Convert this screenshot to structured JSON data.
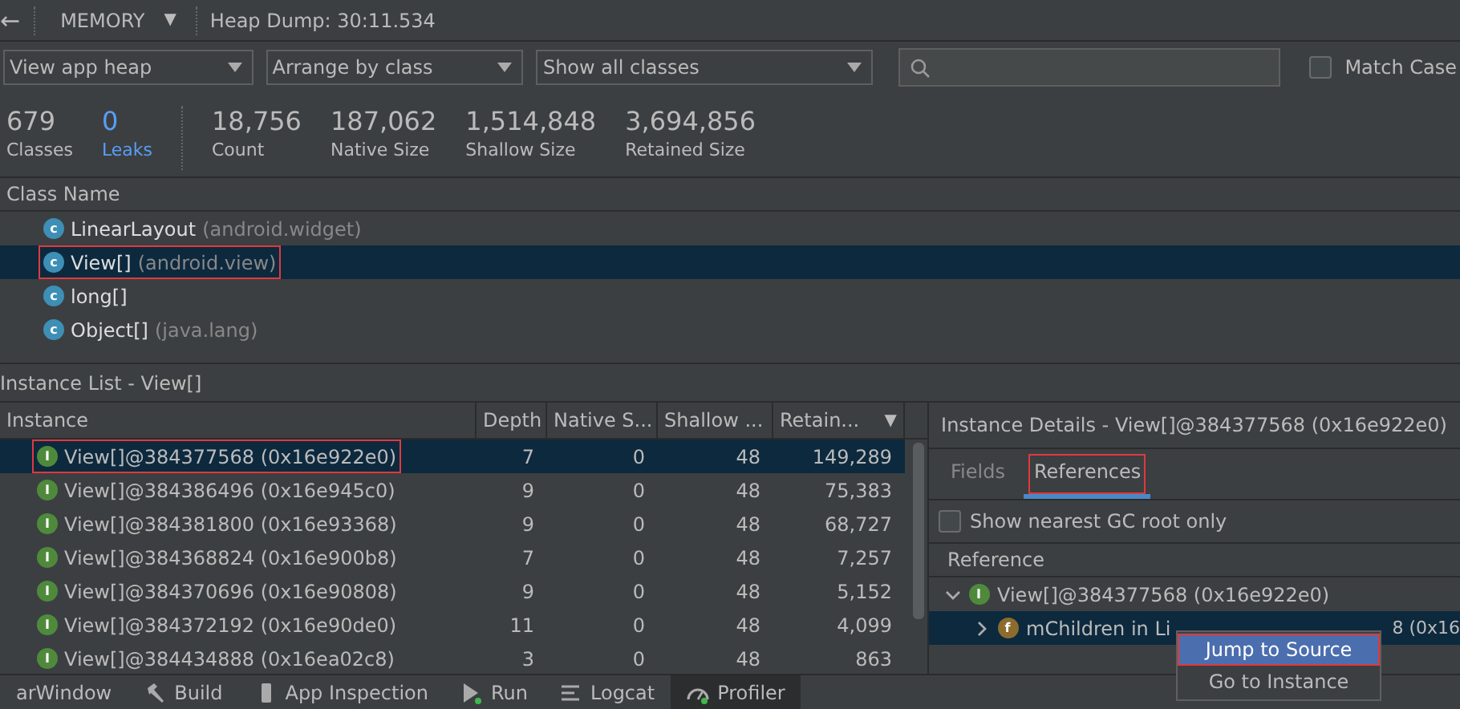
{
  "toolbar": {
    "back": "←",
    "profiler": "MEMORY",
    "dropdown": "▼",
    "session": "Heap Dump: 30:11.534"
  },
  "filters": [
    {
      "label": "View app heap"
    },
    {
      "label": "Arrange by class"
    },
    {
      "label": "Show all classes"
    }
  ],
  "match_case": {
    "label": "Match Case",
    "checked": false
  },
  "stats": [
    {
      "value": "679",
      "label": "Classes",
      "kind": "plain"
    },
    {
      "value": "0",
      "label": "Leaks",
      "kind": "link"
    },
    {
      "value": "18,756",
      "label": "Count",
      "kind": "plain"
    },
    {
      "value": "187,062",
      "label": "Native Size",
      "kind": "plain"
    },
    {
      "value": "1,514,848",
      "label": "Shallow Size",
      "kind": "plain"
    },
    {
      "value": "3,694,856",
      "label": "Retained Size",
      "kind": "plain"
    }
  ],
  "class_table": {
    "header": "Class Name",
    "rows": [
      {
        "icon": "c",
        "name": "LinearLayout",
        "package": "(android.widget)",
        "selected": false,
        "annotated": false
      },
      {
        "icon": "c",
        "name": "View[]",
        "package": "(android.view)",
        "selected": true,
        "annotated": true
      },
      {
        "icon": "c",
        "name": "long[]",
        "package": "",
        "selected": false,
        "annotated": false
      },
      {
        "icon": "c",
        "name": "Object[]",
        "package": "(java.lang)",
        "selected": false,
        "annotated": false
      }
    ]
  },
  "instance_list": {
    "title": "Instance List - View[]",
    "columns": [
      "Instance",
      "Depth",
      "Native S...",
      "Shallow ...",
      "Retain..."
    ],
    "sort_mark": "▼",
    "rows": [
      {
        "icon": "I",
        "instance": "View[]@384377568 (0x16e922e0)",
        "depth": "7",
        "native": "0",
        "shallow": "48",
        "retained": "149,289",
        "selected": true,
        "annotated": true
      },
      {
        "icon": "I",
        "instance": "View[]@384386496 (0x16e945c0)",
        "depth": "9",
        "native": "0",
        "shallow": "48",
        "retained": "75,383",
        "selected": false,
        "annotated": false
      },
      {
        "icon": "I",
        "instance": "View[]@384381800 (0x16e93368)",
        "depth": "9",
        "native": "0",
        "shallow": "48",
        "retained": "68,727",
        "selected": false,
        "annotated": false
      },
      {
        "icon": "I",
        "instance": "View[]@384368824 (0x16e900b8)",
        "depth": "7",
        "native": "0",
        "shallow": "48",
        "retained": "7,257",
        "selected": false,
        "annotated": false
      },
      {
        "icon": "I",
        "instance": "View[]@384370696 (0x16e90808)",
        "depth": "9",
        "native": "0",
        "shallow": "48",
        "retained": "5,152",
        "selected": false,
        "annotated": false
      },
      {
        "icon": "I",
        "instance": "View[]@384372192 (0x16e90de0)",
        "depth": "11",
        "native": "0",
        "shallow": "48",
        "retained": "4,099",
        "selected": false,
        "annotated": false
      },
      {
        "icon": "I",
        "instance": "View[]@384434888 (0x16ea02c8)",
        "depth": "3",
        "native": "0",
        "shallow": "48",
        "retained": "863",
        "selected": false,
        "annotated": false
      }
    ]
  },
  "details": {
    "title": "Instance Details - View[]@384377568 (0x16e922e0)",
    "tabs": [
      {
        "label": "Fields",
        "selected": false,
        "annotated": false
      },
      {
        "label": "References",
        "selected": true,
        "annotated": true
      }
    ],
    "gc_root": {
      "label": "Show nearest GC root only",
      "checked": false
    },
    "header": "Reference",
    "tree": [
      {
        "icon": "I",
        "label": "View[]@384377568 (0x16e922e0)",
        "kind": "instance",
        "expanded": true,
        "selected": false,
        "children": [
          {
            "icon": "f",
            "label": "mChildren in Li",
            "tail": "8 (0x16",
            "kind": "field",
            "expanded": false,
            "selected": true
          }
        ]
      }
    ]
  },
  "context_menu": [
    {
      "label": "Jump to Source",
      "selected": true,
      "annotated": true
    },
    {
      "label": "Go to Instance",
      "selected": false,
      "annotated": false
    }
  ],
  "tool_windows": [
    {
      "label": "arWindow",
      "kind": "plain",
      "selected": false
    },
    {
      "label": "Build",
      "kind": "hammer",
      "selected": false
    },
    {
      "label": "App Inspection",
      "kind": "inspect",
      "selected": false
    },
    {
      "label": "Run",
      "kind": "run",
      "selected": false
    },
    {
      "label": "Logcat",
      "kind": "logcat",
      "selected": false
    },
    {
      "label": "Profiler",
      "kind": "gauge",
      "selected": true
    }
  ]
}
